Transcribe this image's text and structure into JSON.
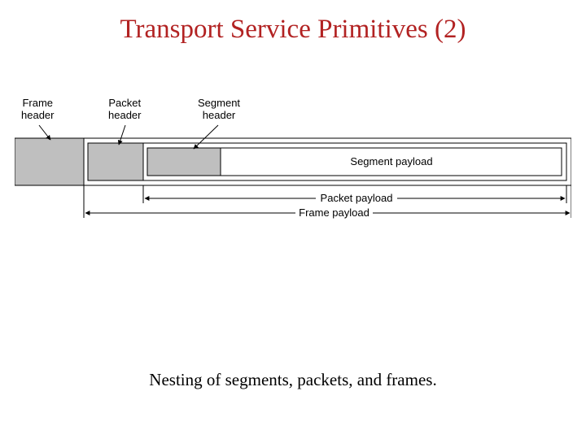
{
  "title": "Transport Service Primitives (2)",
  "labels": {
    "frame_header": "Frame\nheader",
    "packet_header": "Packet\nheader",
    "segment_header": "Segment\nheader",
    "segment_payload": "Segment payload",
    "packet_payload": "Packet payload",
    "frame_payload": "Frame payload"
  },
  "caption": "Nesting of segments, packets, and frames."
}
